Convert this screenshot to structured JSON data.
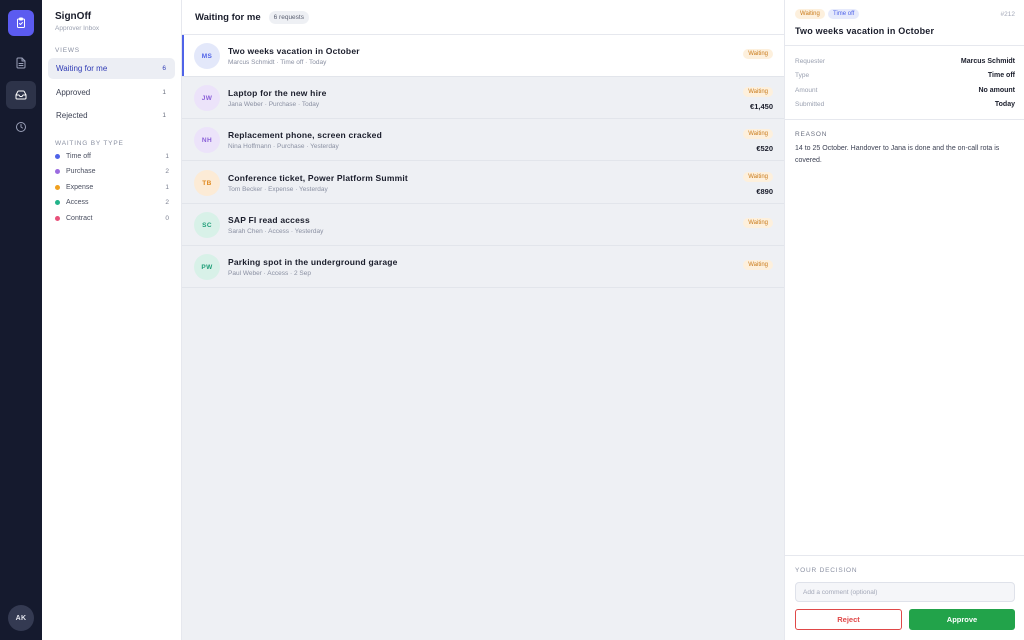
{
  "app": {
    "name": "SignOff",
    "subtitle": "Approver Inbox"
  },
  "rail": {
    "logo_icon": "clipboard-check-icon",
    "items": [
      {
        "icon": "document-icon",
        "active": false
      },
      {
        "icon": "inbox-icon",
        "active": true
      },
      {
        "icon": "clock-icon",
        "active": false
      }
    ],
    "user_initials": "AK"
  },
  "sidebar": {
    "views_label": "VIEWS",
    "views": [
      {
        "label": "Waiting for me",
        "count": "6",
        "active": true
      },
      {
        "label": "Approved",
        "count": "1",
        "active": false
      },
      {
        "label": "Rejected",
        "count": "1",
        "active": false
      }
    ],
    "types_label": "WAITING BY TYPE",
    "types": [
      {
        "label": "Time off",
        "count": "1",
        "color": "#4f63e8"
      },
      {
        "label": "Purchase",
        "count": "2",
        "color": "#9b6be0"
      },
      {
        "label": "Expense",
        "count": "1",
        "color": "#f0a020"
      },
      {
        "label": "Access",
        "count": "2",
        "color": "#22b38a"
      },
      {
        "label": "Contract",
        "count": "0",
        "color": "#e8507a"
      }
    ]
  },
  "list": {
    "title": "Waiting for me",
    "count_label": "6 requests",
    "rows": [
      {
        "initials": "MS",
        "title": "Two weeks vacation in October",
        "meta": "Marcus Schmidt · Time off · Today",
        "status": "Waiting",
        "amount": "",
        "avatar_bg": "#e3e8fa",
        "avatar_fg": "#4f63e8",
        "selected": true
      },
      {
        "initials": "JW",
        "title": "Laptop for the new hire",
        "meta": "Jana Weber · Purchase · Today",
        "status": "Waiting",
        "amount": "€1,450",
        "avatar_bg": "#ece3fa",
        "avatar_fg": "#8a5fd8",
        "selected": false
      },
      {
        "initials": "NH",
        "title": "Replacement phone, screen cracked",
        "meta": "Nina Hoffmann · Purchase · Yesterday",
        "status": "Waiting",
        "amount": "€520",
        "avatar_bg": "#ece3fa",
        "avatar_fg": "#8a5fd8",
        "selected": false
      },
      {
        "initials": "TB",
        "title": "Conference ticket, Power Platform Summit",
        "meta": "Tom Becker · Expense · Yesterday",
        "status": "Waiting",
        "amount": "€890",
        "avatar_bg": "#fcebd6",
        "avatar_fg": "#e08a20",
        "selected": false
      },
      {
        "initials": "SC",
        "title": "SAP FI read access",
        "meta": "Sarah Chen · Access · Yesterday",
        "status": "Waiting",
        "amount": "",
        "avatar_bg": "#d8f1e8",
        "avatar_fg": "#1f9e78",
        "selected": false
      },
      {
        "initials": "PW",
        "title": "Parking spot in the underground garage",
        "meta": "Paul Weber · Access · 2 Sep",
        "status": "Waiting",
        "amount": "",
        "avatar_bg": "#d8f1e8",
        "avatar_fg": "#1f9e78",
        "selected": false
      }
    ]
  },
  "detail": {
    "status": "Waiting",
    "type": "Time off",
    "id": "#212",
    "title": "Two weeks vacation in October",
    "fields": [
      {
        "key": "Requester",
        "value": "Marcus Schmidt"
      },
      {
        "key": "Type",
        "value": "Time off"
      },
      {
        "key": "Amount",
        "value": "No amount"
      },
      {
        "key": "Submitted",
        "value": "Today"
      }
    ],
    "reason_label": "REASON",
    "reason": "14 to 25 October. Handover to Jana is done and the on-call rota is covered.",
    "decision_label": "YOUR DECISION",
    "comment_placeholder": "Add a comment (optional)",
    "reject_label": "Reject",
    "approve_label": "Approve"
  }
}
